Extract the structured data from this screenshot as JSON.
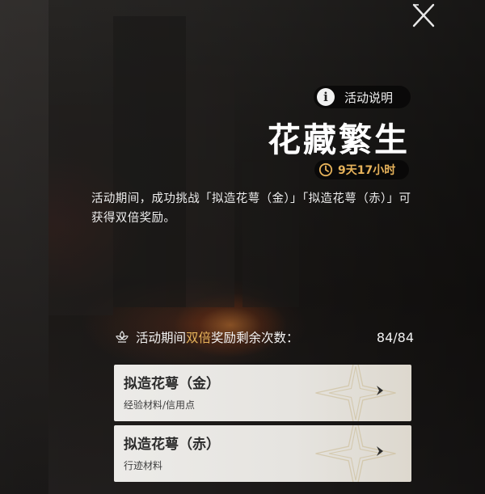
{
  "header": {
    "info_label": "活动说明",
    "title": "花藏繁生",
    "timer": "9天17小时"
  },
  "description": "活动期间，成功挑战「拟造花萼（金）」「拟造花萼（赤）」可获得双倍奖励。",
  "double_reward": {
    "label_prefix": "活动期间",
    "label_highlight": "双倍",
    "label_suffix": "奖励剩余次数：",
    "count": "84/84"
  },
  "stages": [
    {
      "name": "拟造花萼（金）",
      "sub": "经验材料/信用点"
    },
    {
      "name": "拟造花萼（赤）",
      "sub": "行迹材料"
    }
  ],
  "colors": {
    "accent_gold": "#e6b25a",
    "card_bg": "#ecebe8"
  },
  "icons": {
    "close": "close-icon",
    "info": "info-icon",
    "timer": "clock-icon",
    "double": "flower-icon",
    "arrow": "arrow-right-icon"
  }
}
